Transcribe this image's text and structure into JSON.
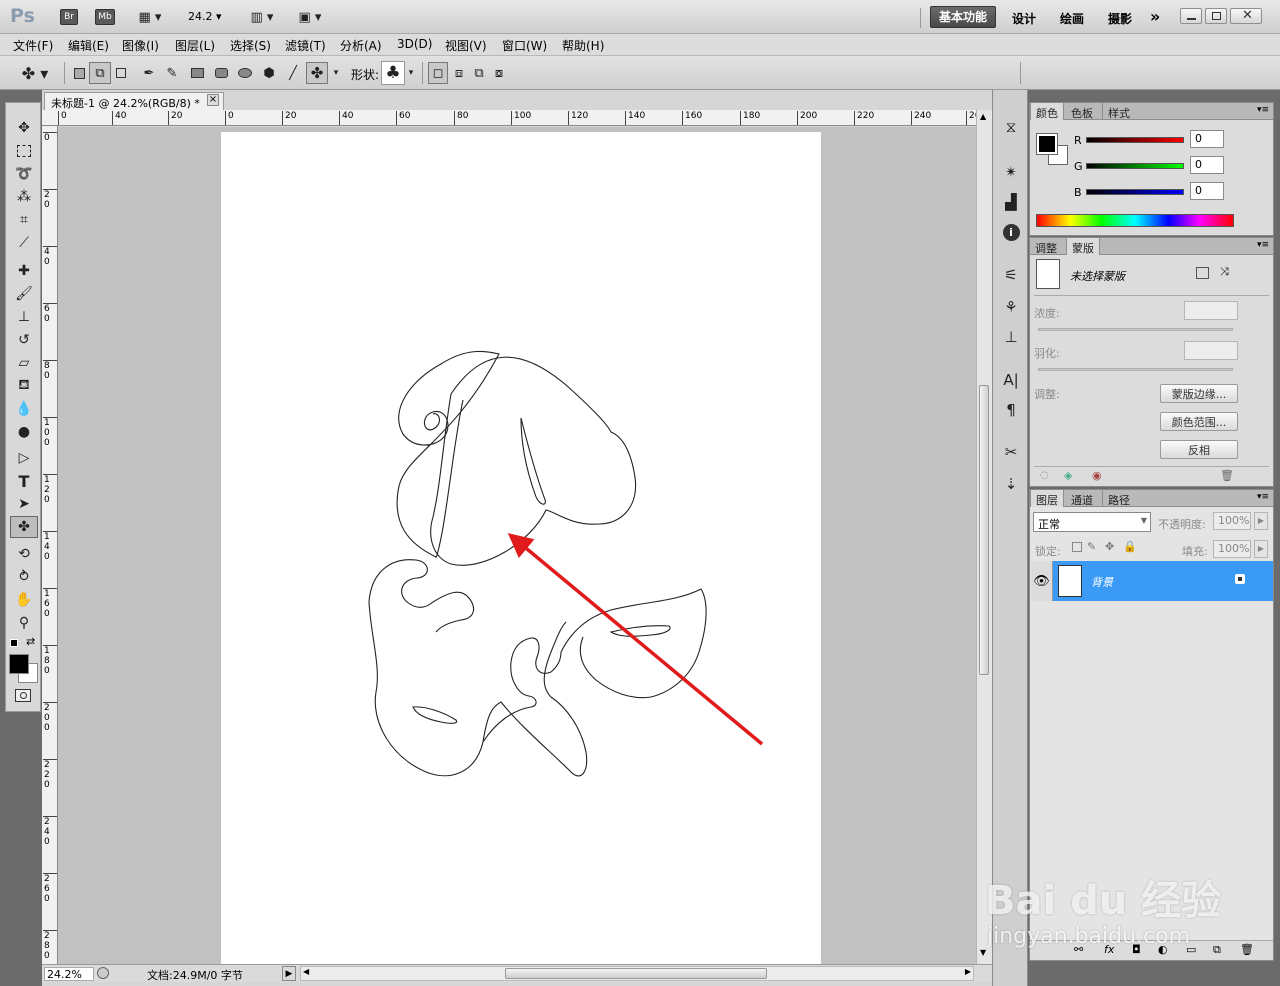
{
  "app": {
    "logo": "Ps",
    "bridge_btn": "Br",
    "minibridge_btn": "Mb",
    "zoom_value": "24.2",
    "workspaces": [
      "基本功能",
      "设计",
      "绘画",
      "摄影"
    ],
    "active_workspace": "基本功能",
    "more_symbol": "»"
  },
  "menu": [
    "文件(F)",
    "编辑(E)",
    "图像(I)",
    "图层(L)",
    "选择(S)",
    "滤镜(T)",
    "分析(A)",
    "3D(D)",
    "视图(V)",
    "窗口(W)",
    "帮助(H)"
  ],
  "options": {
    "shape_label": "形状:"
  },
  "document": {
    "tab_title": "未标题-1 @ 24.2%(RGB/8) *",
    "close_symbol": "×",
    "ruler_top_ticks": [
      "0",
      "40",
      "20",
      "0",
      "20",
      "40",
      "60",
      "80",
      "100",
      "120",
      "140",
      "160",
      "180",
      "200",
      "220",
      "240",
      "26"
    ],
    "ruler_left_ticks": [
      "0",
      "2",
      "4",
      "6",
      "8",
      "10",
      "12",
      "14",
      "16",
      "18",
      "20",
      "22",
      "24",
      "26",
      "28"
    ]
  },
  "status": {
    "zoom": "24.2%",
    "doc_info": "文档:24.9M/0 字节"
  },
  "color_panel": {
    "tabs": [
      "颜色",
      "色板",
      "样式"
    ],
    "r_label": "R",
    "g_label": "G",
    "b_label": "B",
    "r_value": "0",
    "g_value": "0",
    "b_value": "0"
  },
  "masks_panel": {
    "tabs": [
      "调整",
      "蒙版"
    ],
    "mask_name": "未选择蒙版",
    "density_label": "浓度:",
    "feather_label": "羽化:",
    "refine_label": "调整:",
    "mask_edge_btn": "蒙版边缘...",
    "color_range_btn": "颜色范围...",
    "invert_btn": "反相"
  },
  "layers_panel": {
    "tabs": [
      "图层",
      "通道",
      "路径"
    ],
    "blend_mode": "正常",
    "opacity_label": "不透明度:",
    "opacity_value": "100%",
    "lock_label": "锁定:",
    "fill_label": "填充:",
    "fill_value": "100%",
    "layer_name": "背景"
  },
  "watermark": {
    "brand": "Bai du 经验",
    "url": "jingyan.baidu.com"
  },
  "colors": {
    "selection_blue": "#3a9af6",
    "arrow_red": "#e11b1b"
  }
}
